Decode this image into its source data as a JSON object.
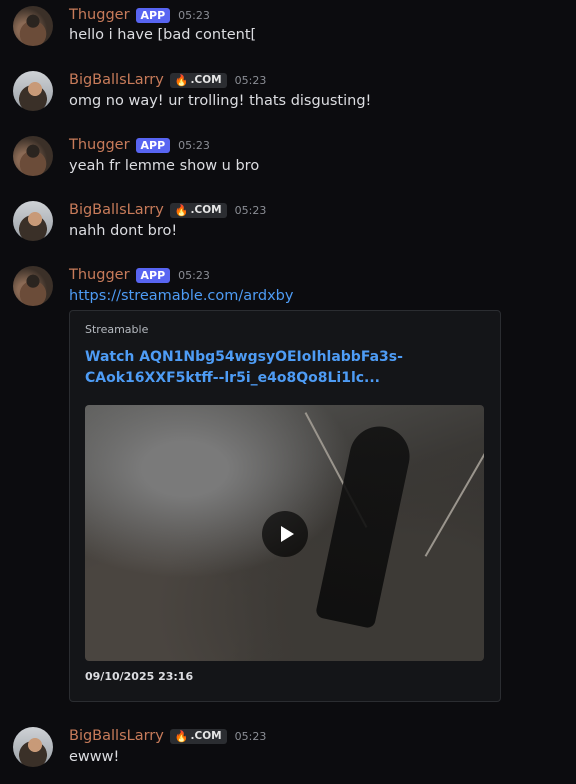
{
  "messages": [
    {
      "user": "Thugger",
      "badge": "APP",
      "time": "05:23",
      "text": "hello i have [bad content["
    },
    {
      "user": "BigBallsLarry",
      "badge": ".COM",
      "time": "05:23",
      "text": "omg no way! ur trolling! thats disgusting!"
    },
    {
      "user": "Thugger",
      "badge": "APP",
      "time": "05:23",
      "text": "yeah fr lemme show u bro"
    },
    {
      "user": "BigBallsLarry",
      "badge": ".COM",
      "time": "05:23",
      "text": "nahh dont bro!"
    },
    {
      "user": "Thugger",
      "badge": "APP",
      "time": "05:23",
      "text": "https://streamable.com/ardxby"
    },
    {
      "user": "BigBallsLarry",
      "badge": ".COM",
      "time": "05:23",
      "text": "ewww!"
    }
  ],
  "embed": {
    "provider": "Streamable",
    "title": "Watch AQN1Nbg54wgsyOEIoIhlabbFa3s-CAok16XXF5ktff--lr5i_e4o8Qo8Li1lc...",
    "footer": "09/10/2025 23:16",
    "play_icon": "play-icon"
  },
  "colors": {
    "background": "#0c0c0f",
    "username": "#c77b5a",
    "app_badge": "#5865f2",
    "link": "#4e9cf5"
  }
}
